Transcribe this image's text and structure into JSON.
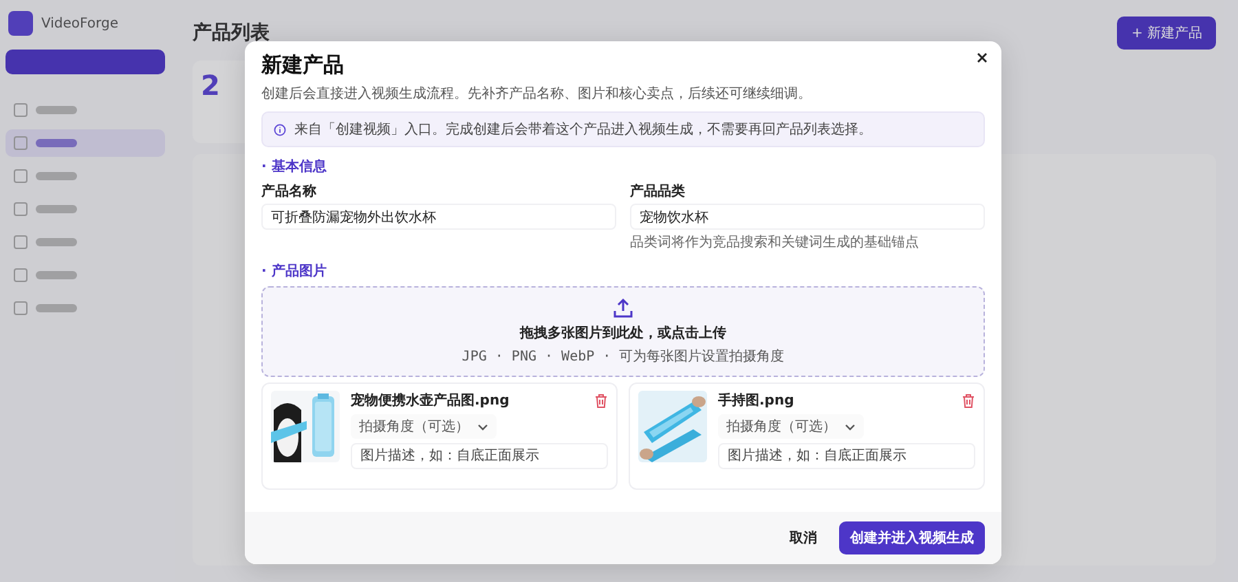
{
  "app": {
    "name": "VideoForge",
    "new_button": "+ 新建产品"
  },
  "sidebar": {
    "items": [
      {
        "selected": false
      },
      {
        "selected": true
      },
      {
        "selected": false
      },
      {
        "selected": false
      },
      {
        "selected": false
      },
      {
        "selected": false
      },
      {
        "selected": false
      }
    ]
  },
  "page": {
    "title": "产品列表",
    "stat_value": "2"
  },
  "dialog": {
    "title": "新建产品",
    "subtitle": "创建后会直接进入视频生成流程。先补齐产品名称、图片和核心卖点，后续还可继续细调。",
    "notice": "来自「创建视频」入口。完成创建后会带着这个产品进入视频生成，不需要再回产品列表选择。",
    "basic_section": "· 基本信息",
    "fields": [
      {
        "label": "产品名称",
        "value": "可折叠防漏宠物外出饮水杯"
      },
      {
        "label": "产品品类",
        "value": "宠物饮水杯",
        "help": "品类词将作为竞品搜索和关键词生成的基础锚点"
      }
    ],
    "images_section": "· 产品图片",
    "upload": {
      "title": "拖拽多张图片到此处，或点击上传",
      "hint": "JPG · PNG · WebP · 可为每张图片设置拍摄角度"
    },
    "images": [
      {
        "filename": "宠物便携水壶产品图.png",
        "angle_placeholder": "拍摄角度（可选）",
        "description_placeholder": "图片描述，如：自底正面展示",
        "kind": "picture"
      },
      {
        "filename": "手持图.png",
        "angle_placeholder": "拍摄角度（可选）",
        "description_placeholder": "图片描述，如：自底正面展示",
        "kind": "picture"
      }
    ],
    "buttons": {
      "cancel": "取消",
      "submit": "创建并进入视频生成"
    }
  }
}
